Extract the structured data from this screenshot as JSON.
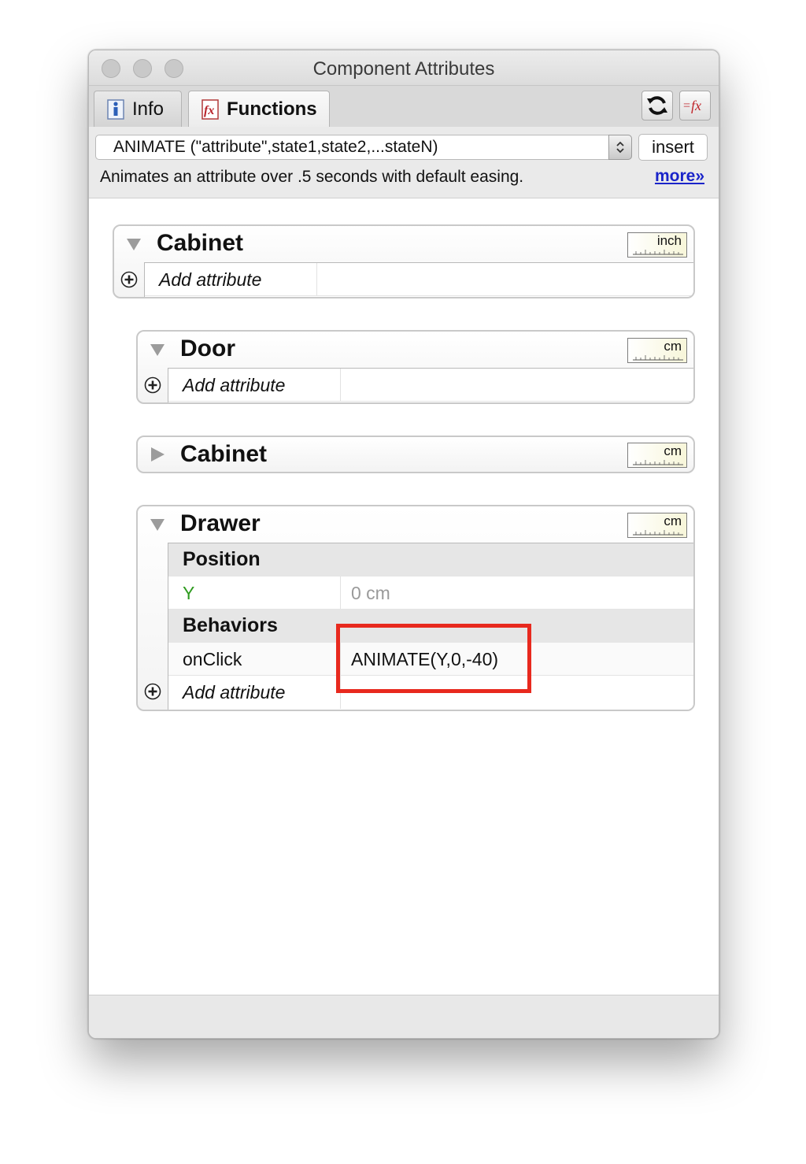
{
  "window": {
    "title": "Component Attributes"
  },
  "tabs": [
    {
      "label": "Info",
      "icon": "info-icon",
      "active": false
    },
    {
      "label": "Functions",
      "icon": "fx-icon",
      "active": true
    }
  ],
  "toolbar": {
    "refresh_icon": "refresh-icon",
    "formula_icon": "formula-icon"
  },
  "function_bar": {
    "selected_function": "ANIMATE (\"attribute\",state1,state2,...stateN)",
    "insert_label": "insert",
    "description": "Animates an attribute over .5 seconds with default easing.",
    "more_label": "more»"
  },
  "components": [
    {
      "name": "Cabinet",
      "unit": "inch",
      "expanded": true,
      "add_label": "Add attribute"
    },
    {
      "name": "Door",
      "unit": "cm",
      "expanded": true,
      "add_label": "Add attribute"
    },
    {
      "name": "Cabinet",
      "unit": "cm",
      "expanded": false
    },
    {
      "name": "Drawer",
      "unit": "cm",
      "expanded": true,
      "sections": [
        {
          "title": "Position",
          "rows": [
            {
              "key": "Y",
              "value": "0 cm",
              "key_color": "#2e9b1f",
              "value_color": "#9a9a9a"
            }
          ]
        },
        {
          "title": "Behaviors",
          "rows": [
            {
              "key": "onClick",
              "value": "ANIMATE(Y,0,-40)"
            }
          ]
        }
      ],
      "add_label": "Add attribute"
    }
  ],
  "colors": {
    "highlight": "#e8291e",
    "link": "#1a24c9",
    "green_key": "#2e9b1f"
  }
}
